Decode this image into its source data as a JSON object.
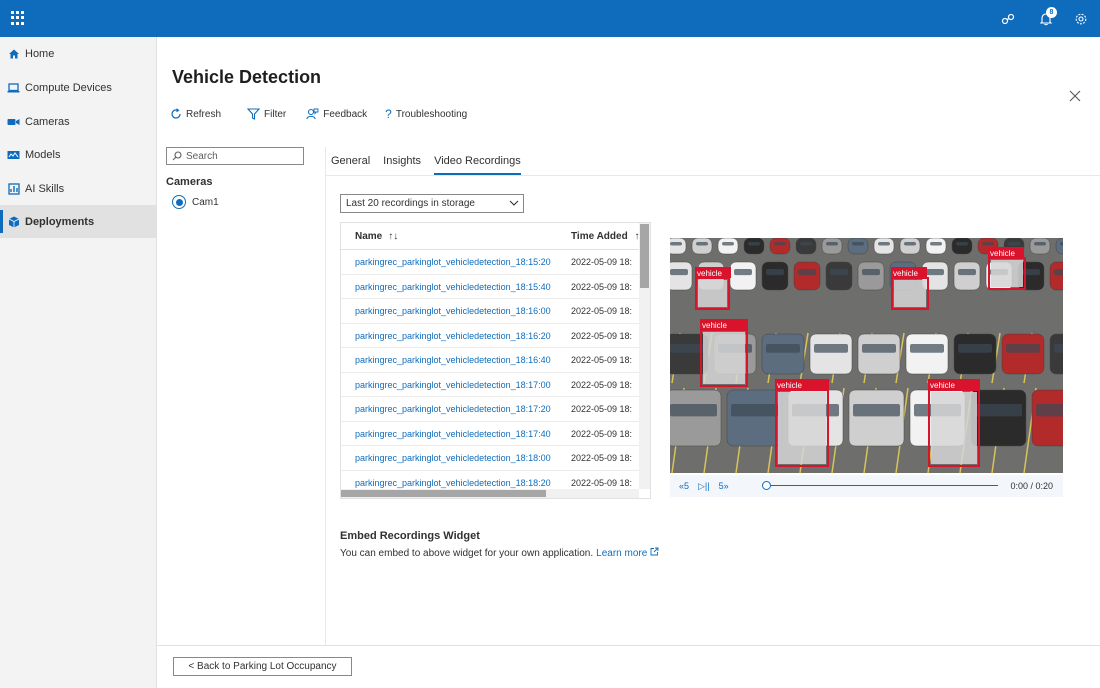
{
  "topbar": {
    "notification_count": "8",
    "icons": [
      "app-launcher-icon",
      "connection-icon",
      "bell-icon",
      "gear-icon"
    ]
  },
  "sidebar": {
    "items": [
      {
        "label": "Home",
        "icon": "home-icon"
      },
      {
        "label": "Compute Devices",
        "icon": "laptop-icon"
      },
      {
        "label": "Cameras",
        "icon": "video-camera-icon"
      },
      {
        "label": "Models",
        "icon": "model-icon"
      },
      {
        "label": "AI Skills",
        "icon": "skills-icon"
      },
      {
        "label": "Deployments",
        "icon": "cube-icon",
        "active": true
      }
    ]
  },
  "page": {
    "title": "Vehicle Detection"
  },
  "toolbar": {
    "refresh": "Refresh",
    "filter": "Filter",
    "feedback": "Feedback",
    "troubleshooting": "Troubleshooting"
  },
  "left_panel": {
    "search_placeholder": "Search",
    "cameras_heading": "Cameras",
    "camera": "Cam1"
  },
  "tabs": [
    "General",
    "Insights",
    "Video Recordings"
  ],
  "active_tab": "Video Recordings",
  "recordings": {
    "dropdown": "Last 20 recordings in storage",
    "columns": {
      "name": "Name",
      "time": "Time Added"
    },
    "rows": [
      {
        "name": "parkingrec_parkinglot_vehicledetection_18:15:20",
        "time": "2022-05-09 18:"
      },
      {
        "name": "parkingrec_parkinglot_vehicledetection_18:15:40",
        "time": "2022-05-09 18:"
      },
      {
        "name": "parkingrec_parkinglot_vehicledetection_18:16:00",
        "time": "2022-05-09 18:"
      },
      {
        "name": "parkingrec_parkinglot_vehicledetection_18:16:20",
        "time": "2022-05-09 18:"
      },
      {
        "name": "parkingrec_parkinglot_vehicledetection_18:16:40",
        "time": "2022-05-09 18:"
      },
      {
        "name": "parkingrec_parkinglot_vehicledetection_18:17:00",
        "time": "2022-05-09 18:"
      },
      {
        "name": "parkingrec_parkinglot_vehicledetection_18:17:20",
        "time": "2022-05-09 18:"
      },
      {
        "name": "parkingrec_parkinglot_vehicledetection_18:17:40",
        "time": "2022-05-09 18:"
      },
      {
        "name": "parkingrec_parkinglot_vehicledetection_18:18:00",
        "time": "2022-05-09 18:"
      },
      {
        "name": "parkingrec_parkinglot_vehicledetection_18:18:20",
        "time": "2022-05-09 18:"
      }
    ]
  },
  "player": {
    "detection_label": "vehicle",
    "rewind": "«5",
    "play_pause": "▷||",
    "forward": "5»",
    "time": "0:00 / 0:20",
    "box_color": "#d9132c"
  },
  "embed": {
    "title": "Embed Recordings Widget",
    "description": "You can embed to above widget for your own application.",
    "link": "Learn more"
  },
  "footer": {
    "back": "< Back to Parking Lot Occupancy"
  }
}
